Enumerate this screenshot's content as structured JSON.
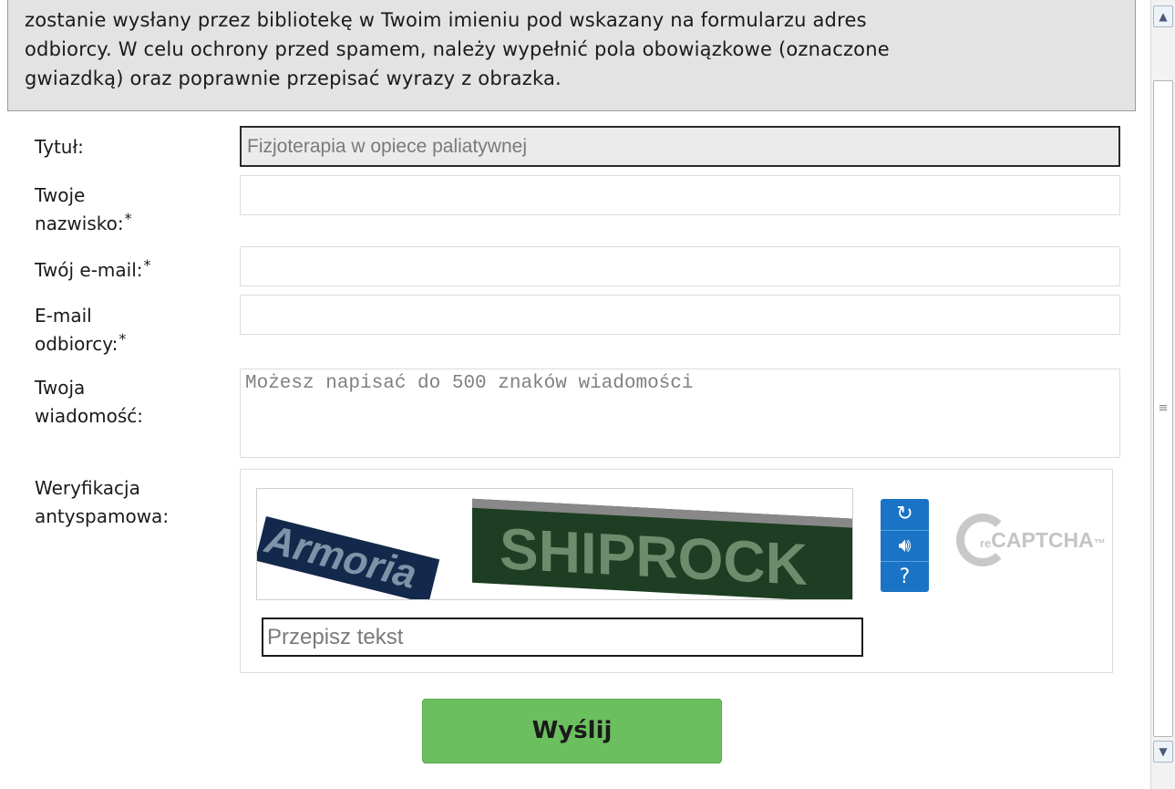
{
  "intro": {
    "line1": "zostanie wysłany przez bibliotekę w Twoim imieniu pod wskazany na formularzu adres",
    "line2": "odbiorcy. W celu ochrony przed spamem, należy wypełnić pola obowiązkowe (oznaczone",
    "line3": "gwiazdką) oraz poprawnie przepisać wyrazy z obrazka."
  },
  "form": {
    "title_label": "Tytuł:",
    "title_value": "Fizjoterapia w opiece paliatywnej",
    "name_label_1": "Twoje",
    "name_label_2": "nazwisko:",
    "email_label": "Twój e-mail:",
    "recipient_label_1": "E-mail",
    "recipient_label_2": "odbiorcy:",
    "message_label_1": "Twoja",
    "message_label_2": "wiadomość:",
    "message_placeholder": "Możesz napisać do 500 znaków wiadomości",
    "required_mark": "*",
    "captcha_label_1": "Weryfikacja",
    "captcha_label_2": "antyspamowa:",
    "submit_label": "Wyślij"
  },
  "captcha": {
    "word1": "Armoria",
    "word2": "SHIPROCK",
    "input_placeholder": "Przepisz tekst",
    "logo_text_small": "re",
    "logo_text": "CAPTCHA",
    "logo_tm": "™",
    "icons": [
      "refresh-icon",
      "audio-icon",
      "help-icon"
    ]
  },
  "colors": {
    "submit_bg": "#6cbf5f",
    "captcha_controls": "#1a73c4",
    "info_bg": "#e3e3e3"
  }
}
